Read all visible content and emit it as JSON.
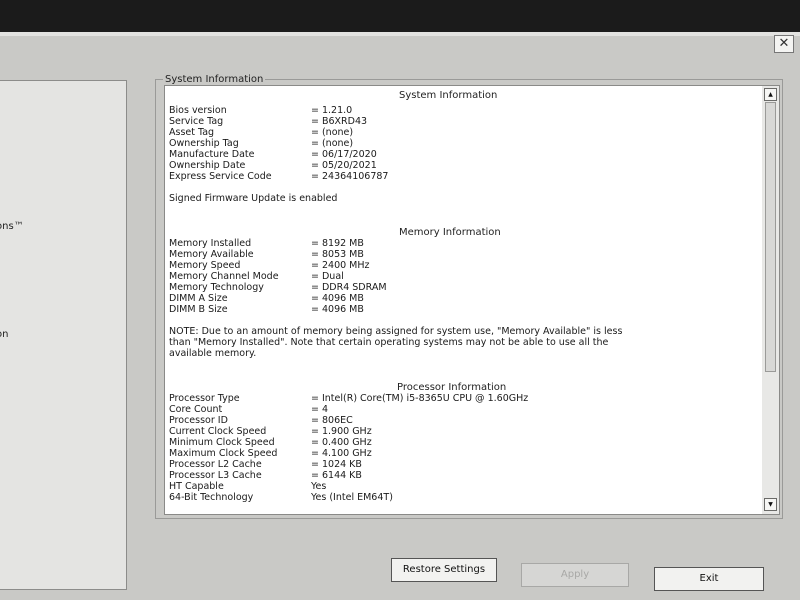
{
  "window": {
    "close_symbol": "✕"
  },
  "left_nav": {
    "items": [
      "ons™",
      "on"
    ]
  },
  "group_title": "System Information",
  "system": {
    "heading": "System Information",
    "rows": [
      {
        "label": "Bios version",
        "value": "= 1.21.0"
      },
      {
        "label": "Service Tag",
        "value": "= B6XRD43"
      },
      {
        "label": "Asset Tag",
        "value": "= (none)"
      },
      {
        "label": "Ownership Tag",
        "value": "= (none)"
      },
      {
        "label": "Manufacture Date",
        "value": "= 06/17/2020"
      },
      {
        "label": "Ownership Date",
        "value": "= 05/20/2021"
      },
      {
        "label": "Express Service Code",
        "value": "= 24364106787"
      }
    ],
    "firmware_note": "Signed Firmware Update is enabled"
  },
  "memory": {
    "heading": "Memory Information",
    "rows": [
      {
        "label": "Memory Installed",
        "value": "= 8192 MB"
      },
      {
        "label": "Memory Available",
        "value": "= 8053 MB"
      },
      {
        "label": "Memory Speed",
        "value": "= 2400 MHz"
      },
      {
        "label": "Memory Channel Mode",
        "value": "= Dual"
      },
      {
        "label": "Memory Technology",
        "value": "= DDR4 SDRAM"
      },
      {
        "label": "DIMM A Size",
        "value": "= 4096 MB"
      },
      {
        "label": "DIMM B Size",
        "value": "= 4096 MB"
      }
    ],
    "note": [
      "NOTE: Due to an amount of memory being assigned for system use, \"Memory Available\" is less",
      "than \"Memory Installed\". Note that certain operating systems may not be able to use all the",
      "available memory."
    ]
  },
  "processor": {
    "heading": "Processor Information",
    "rows": [
      {
        "label": "Processor Type",
        "value": "= Intel(R) Core(TM) i5-8365U CPU @ 1.60GHz"
      },
      {
        "label": "Core Count",
        "value": "= 4"
      },
      {
        "label": "Processor ID",
        "value": "= 806EC"
      },
      {
        "label": "Current Clock Speed",
        "value": "= 1.900 GHz"
      },
      {
        "label": "Minimum Clock Speed",
        "value": "= 0.400 GHz"
      },
      {
        "label": "Maximum Clock Speed",
        "value": "= 4.100 GHz"
      },
      {
        "label": "Processor L2 Cache",
        "value": "= 1024 KB"
      },
      {
        "label": "Processor L3 Cache",
        "value": "= 6144 KB"
      },
      {
        "label": "HT Capable",
        "value": "Yes"
      },
      {
        "label": "64-Bit Technology",
        "value": "Yes (Intel EM64T)"
      }
    ]
  },
  "scrollbar": {
    "up_symbol": "▲",
    "down_symbol": "▼"
  },
  "buttons": {
    "restore": "Restore Settings",
    "apply": "Apply",
    "exit": "Exit"
  }
}
